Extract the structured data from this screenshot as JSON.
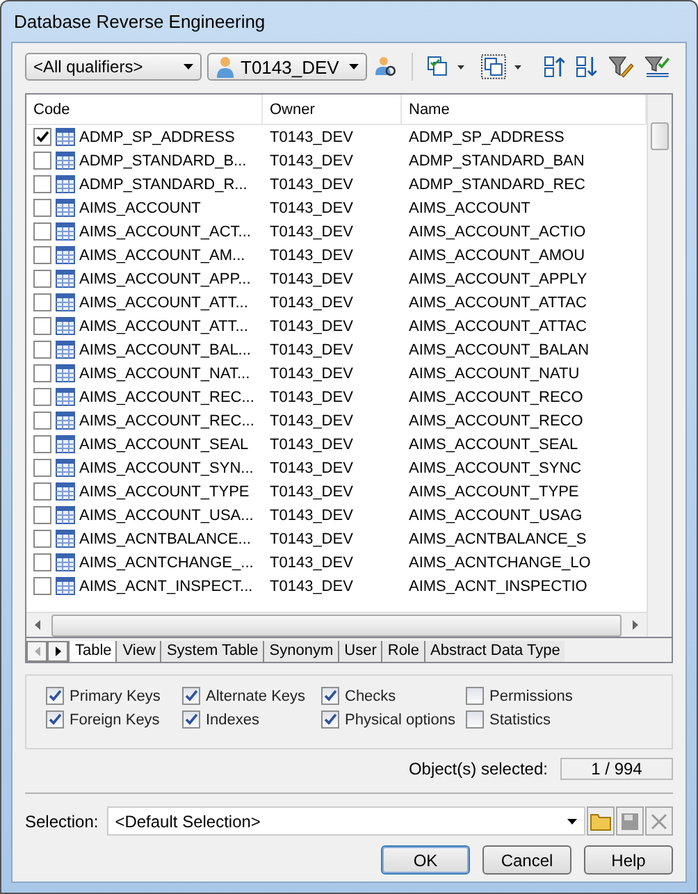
{
  "window": {
    "title": "Database Reverse Engineering"
  },
  "toolbar": {
    "qualifier": "<All qualifiers>",
    "owner": "T0143_DEV"
  },
  "table": {
    "columns": [
      "Code",
      "Owner",
      "Name"
    ],
    "rows": [
      {
        "checked": true,
        "code": "ADMP_SP_ADDRESS",
        "owner": "T0143_DEV",
        "name": "ADMP_SP_ADDRESS"
      },
      {
        "checked": false,
        "code": "ADMP_STANDARD_B...",
        "owner": "T0143_DEV",
        "name": "ADMP_STANDARD_BAN"
      },
      {
        "checked": false,
        "code": "ADMP_STANDARD_R...",
        "owner": "T0143_DEV",
        "name": "ADMP_STANDARD_REC"
      },
      {
        "checked": false,
        "code": "AIMS_ACCOUNT",
        "owner": "T0143_DEV",
        "name": "AIMS_ACCOUNT"
      },
      {
        "checked": false,
        "code": "AIMS_ACCOUNT_ACT...",
        "owner": "T0143_DEV",
        "name": "AIMS_ACCOUNT_ACTIO"
      },
      {
        "checked": false,
        "code": "AIMS_ACCOUNT_AM...",
        "owner": "T0143_DEV",
        "name": "AIMS_ACCOUNT_AMOU"
      },
      {
        "checked": false,
        "code": "AIMS_ACCOUNT_APP...",
        "owner": "T0143_DEV",
        "name": "AIMS_ACCOUNT_APPLY"
      },
      {
        "checked": false,
        "code": "AIMS_ACCOUNT_ATT...",
        "owner": "T0143_DEV",
        "name": "AIMS_ACCOUNT_ATTAC"
      },
      {
        "checked": false,
        "code": "AIMS_ACCOUNT_ATT...",
        "owner": "T0143_DEV",
        "name": "AIMS_ACCOUNT_ATTAC"
      },
      {
        "checked": false,
        "code": "AIMS_ACCOUNT_BAL...",
        "owner": "T0143_DEV",
        "name": "AIMS_ACCOUNT_BALAN"
      },
      {
        "checked": false,
        "code": "AIMS_ACCOUNT_NAT...",
        "owner": "T0143_DEV",
        "name": "AIMS_ACCOUNT_NATU"
      },
      {
        "checked": false,
        "code": "AIMS_ACCOUNT_REC...",
        "owner": "T0143_DEV",
        "name": "AIMS_ACCOUNT_RECO"
      },
      {
        "checked": false,
        "code": "AIMS_ACCOUNT_REC...",
        "owner": "T0143_DEV",
        "name": "AIMS_ACCOUNT_RECO"
      },
      {
        "checked": false,
        "code": "AIMS_ACCOUNT_SEAL",
        "owner": "T0143_DEV",
        "name": "AIMS_ACCOUNT_SEAL"
      },
      {
        "checked": false,
        "code": "AIMS_ACCOUNT_SYN...",
        "owner": "T0143_DEV",
        "name": "AIMS_ACCOUNT_SYNC"
      },
      {
        "checked": false,
        "code": "AIMS_ACCOUNT_TYPE",
        "owner": "T0143_DEV",
        "name": "AIMS_ACCOUNT_TYPE"
      },
      {
        "checked": false,
        "code": "AIMS_ACCOUNT_USA...",
        "owner": "T0143_DEV",
        "name": "AIMS_ACCOUNT_USAG"
      },
      {
        "checked": false,
        "code": "AIMS_ACNTBALANCE...",
        "owner": "T0143_DEV",
        "name": "AIMS_ACNTBALANCE_S"
      },
      {
        "checked": false,
        "code": "AIMS_ACNTCHANGE_...",
        "owner": "T0143_DEV",
        "name": "AIMS_ACNTCHANGE_LO"
      },
      {
        "checked": false,
        "code": "AIMS_ACNT_INSPECT...",
        "owner": "T0143_DEV",
        "name": "AIMS_ACNT_INSPECTIO"
      }
    ]
  },
  "tabs": [
    {
      "label": "Table",
      "selected": true
    },
    {
      "label": "View",
      "selected": false
    },
    {
      "label": "System Table",
      "selected": false
    },
    {
      "label": "Synonym",
      "selected": false
    },
    {
      "label": "User",
      "selected": false
    },
    {
      "label": "Role",
      "selected": false
    },
    {
      "label": "Abstract Data Type",
      "selected": false
    }
  ],
  "options": [
    {
      "label": "Primary Keys",
      "checked": true
    },
    {
      "label": "Alternate Keys",
      "checked": true
    },
    {
      "label": "Checks",
      "checked": true
    },
    {
      "label": "Permissions",
      "checked": false
    },
    {
      "label": "Foreign Keys",
      "checked": true
    },
    {
      "label": "Indexes",
      "checked": true
    },
    {
      "label": "Physical options",
      "checked": true
    },
    {
      "label": "Statistics",
      "checked": false
    }
  ],
  "selected_count": {
    "label": "Object(s) selected:",
    "value": "1 / 994"
  },
  "selection": {
    "label": "Selection:",
    "value": "<Default Selection>"
  },
  "buttons": [
    "OK",
    "Cancel",
    "Help"
  ]
}
